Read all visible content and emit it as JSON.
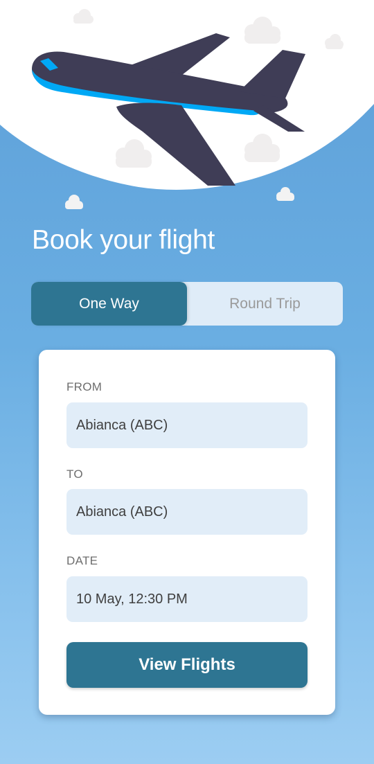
{
  "hero": {
    "illustration_icon": "airplane-icon",
    "colors": {
      "plane_body": "#3f3d56",
      "plane_stripe": "#00a8f5",
      "cloud": "#f1f1f1",
      "moon": "#ffffff"
    }
  },
  "title": "Book your flight",
  "trip_type": {
    "options": [
      "One Way",
      "Round Trip"
    ],
    "selected": "One Way"
  },
  "form": {
    "from": {
      "label": "FROM",
      "value": "Abianca (ABC)"
    },
    "to": {
      "label": "TO",
      "value": "Abianca (ABC)"
    },
    "date": {
      "label": "DATE",
      "value": "10 May, 12:30 PM"
    },
    "submit_label": "View Flights"
  },
  "colors": {
    "primary": "#2e7592",
    "field_bg": "#e1edf8",
    "background_top": "#5d9fd8",
    "background_bottom": "#9ccdf2"
  }
}
